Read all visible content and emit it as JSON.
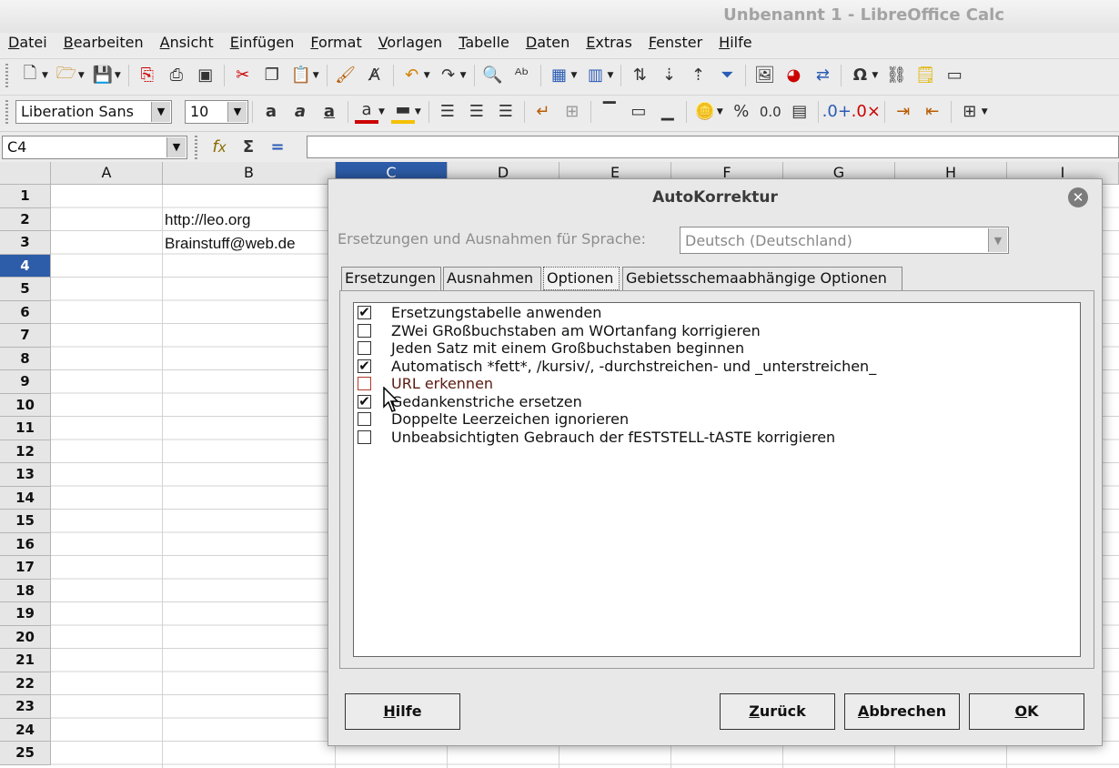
{
  "window": {
    "title": "Unbenannt 1 - LibreOffice Calc"
  },
  "menu": [
    "Datei",
    "Bearbeiten",
    "Ansicht",
    "Einfügen",
    "Format",
    "Vorlagen",
    "Tabelle",
    "Daten",
    "Extras",
    "Fenster",
    "Hilfe"
  ],
  "toolbar": {
    "font_name": "Liberation Sans",
    "font_size": "10",
    "percent_icon": "%",
    "number_format_icon": "0.0"
  },
  "formula_bar": {
    "cell_ref": "C4",
    "content": ""
  },
  "sheet": {
    "columns": [
      "A",
      "B",
      "C",
      "D",
      "E",
      "F",
      "G",
      "H",
      "I"
    ],
    "selected_column": "C",
    "rows": [
      "1",
      "2",
      "3",
      "4",
      "5",
      "6",
      "7",
      "8",
      "9",
      "10",
      "11",
      "12",
      "13",
      "14",
      "15",
      "16",
      "17",
      "18",
      "19",
      "20",
      "21",
      "22",
      "23",
      "24",
      "25"
    ],
    "selected_row": "4",
    "cells": {
      "B2": "http://leo.org",
      "B3": "Brainstuff@web.de"
    }
  },
  "dialog": {
    "title": "AutoKorrektur",
    "language_label": "Ersetzungen und Ausnahmen für Sprache:",
    "language_value": "Deutsch (Deutschland)",
    "tabs": [
      "Ersetzungen",
      "Ausnahmen",
      "Optionen",
      "Gebietsschemaabhängige Optionen"
    ],
    "active_tab": "Optionen",
    "options": [
      {
        "label": "Ersetzungstabelle anwenden",
        "checked": true
      },
      {
        "label": "ZWei GRoßbuchstaben am WOrtanfang korrigieren",
        "checked": false
      },
      {
        "label": "Jeden Satz mit einem Großbuchstaben beginnen",
        "checked": false
      },
      {
        "label": "Automatisch *fett*, /kursiv/, -durchstreichen- und _unterstreichen_",
        "checked": true
      },
      {
        "label": "URL erkennen",
        "checked": false
      },
      {
        "label": "Gedankenstriche ersetzen",
        "checked": true
      },
      {
        "label": "Doppelte Leerzeichen ignorieren",
        "checked": false
      },
      {
        "label": "Unbeabsichtigten Gebrauch der fESTSTELL-tASTE korrigieren",
        "checked": false
      }
    ],
    "buttons": {
      "help": "Hilfe",
      "back": "Zurück",
      "cancel": "Abbrechen",
      "ok": "OK"
    },
    "check_glyph": "✔",
    "close_glyph": "✕"
  }
}
